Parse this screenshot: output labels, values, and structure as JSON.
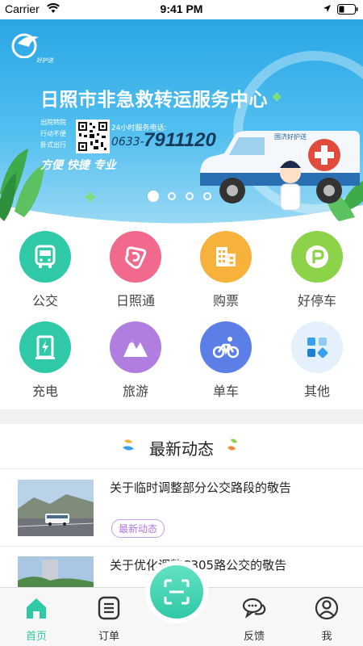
{
  "status_bar": {
    "carrier": "Carrier",
    "time": "9:41 PM"
  },
  "banner": {
    "logo_text": "好护送",
    "title": "日照市非急救转运服务中心",
    "features": [
      "出院转院",
      "行动不便",
      "卧式出行"
    ],
    "hotline_label": "24小时服务电话:",
    "phone_prefix": "0633-",
    "phone_number": "7911120",
    "slogan": "方便  快捷  专业",
    "ambulance_brand": "国济好护送",
    "slides_total": 4,
    "active_slide": 1
  },
  "grid": [
    {
      "label": "公交",
      "icon": "bus-icon",
      "color": "#30c9a8"
    },
    {
      "label": "日照通",
      "icon": "rizhaotong-icon",
      "color": "#f16a8e"
    },
    {
      "label": "购票",
      "icon": "building-icon",
      "color": "#f7b23c"
    },
    {
      "label": "好停车",
      "icon": "parking-icon",
      "color": "#8cd34a"
    },
    {
      "label": "充电",
      "icon": "charging-icon",
      "color": "#30c9a8"
    },
    {
      "label": "旅游",
      "icon": "mountain-icon",
      "color": "#b07ee0"
    },
    {
      "label": "单车",
      "icon": "bicycle-icon",
      "color": "#5b7fe6"
    },
    {
      "label": "其他",
      "icon": "more-apps-icon",
      "color": "#e4f1fc"
    }
  ],
  "news": {
    "section_title": "最新动态",
    "items": [
      {
        "headline": "关于临时调整部分公交路段的敬告",
        "tag": "最新动态"
      },
      {
        "headline": "关于优化调整C305路公交的敬告",
        "tag": ""
      }
    ]
  },
  "tabbar": {
    "accent": "#30c9a8",
    "tabs": [
      {
        "label": "首页",
        "active": true
      },
      {
        "label": "订单",
        "active": false
      },
      {
        "label": "反馈",
        "active": false
      },
      {
        "label": "我",
        "active": false
      }
    ],
    "center": "scan-icon"
  }
}
